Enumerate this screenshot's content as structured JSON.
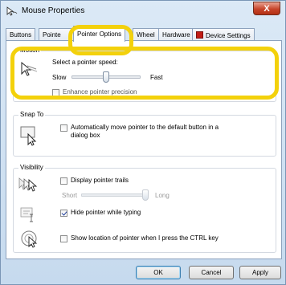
{
  "window": {
    "title": "Mouse Properties",
    "close_label": "X"
  },
  "tabs": [
    {
      "label": "Buttons"
    },
    {
      "label": "Pointe"
    },
    {
      "label": "Pointer Options",
      "active": true
    },
    {
      "label": "Wheel"
    },
    {
      "label": "Hardware"
    },
    {
      "label": "Device Settings"
    }
  ],
  "motion": {
    "title": "Motion",
    "speed_label": "Select a pointer speed:",
    "slow": "Slow",
    "fast": "Fast",
    "speed_level": 0.5,
    "precision_label": "Enhance pointer precision"
  },
  "snap": {
    "title": "Snap To",
    "line1": "Automatically move pointer to the default button in a",
    "line2": "dialog box",
    "checked": false
  },
  "visibility": {
    "title": "Visibility",
    "trails_label": "Display pointer trails",
    "trails_checked": false,
    "short": "Short",
    "long": "Long",
    "trails_level": 1.0,
    "hide_label": "Hide pointer while typing",
    "hide_checked": true,
    "ctrl_label": "Show location of pointer when I press the CTRL key",
    "ctrl_checked": false
  },
  "buttons": {
    "ok": "OK",
    "cancel": "Cancel",
    "apply": "Apply"
  },
  "colors": {
    "highlight": "#f3d10c",
    "close": "#c7452b",
    "checkmark": "#1f3e9a"
  }
}
